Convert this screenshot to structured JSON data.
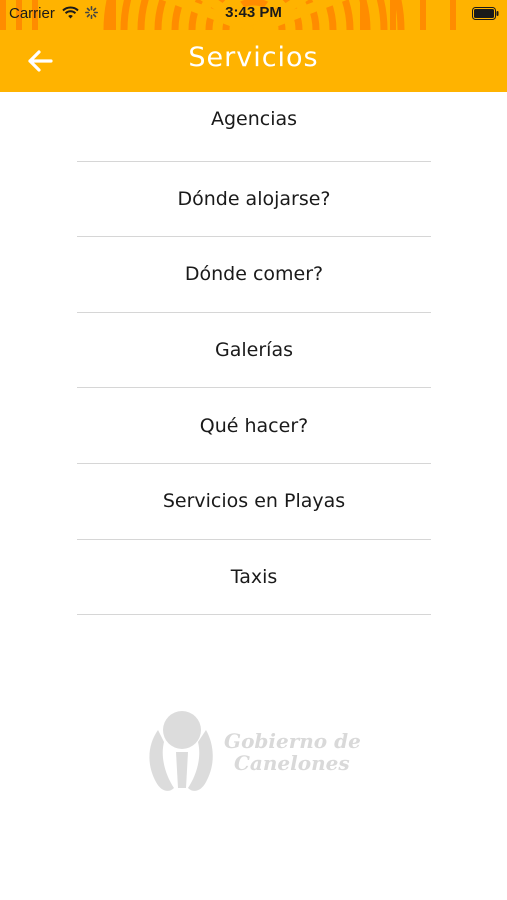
{
  "status_bar": {
    "carrier": "Carrier",
    "time": "3:43 PM"
  },
  "header": {
    "title": "Servicios",
    "background_color": "#FFB300",
    "pattern_color": "#FF8C00",
    "back_icon": "arrow-left-icon"
  },
  "services": {
    "items": [
      {
        "label": "Agencias"
      },
      {
        "label": "Dónde alojarse?"
      },
      {
        "label": "Dónde comer?"
      },
      {
        "label": "Galerías"
      },
      {
        "label": "Qué hacer?"
      },
      {
        "label": "Servicios en Playas"
      },
      {
        "label": "Taxis"
      }
    ]
  },
  "logo": {
    "line1": "Gobierno de",
    "line2": "Canelones",
    "color": "#d9d9d9"
  }
}
